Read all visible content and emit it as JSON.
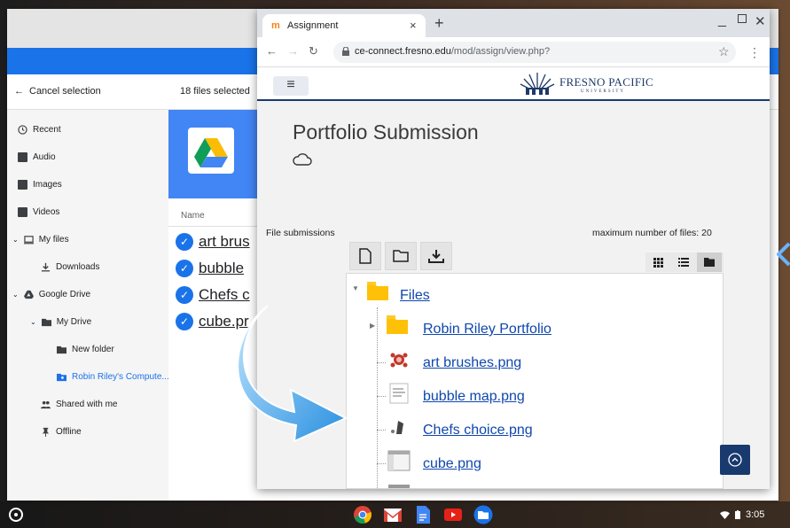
{
  "files_app": {
    "toolbar": {
      "cancel_selection": "Cancel selection",
      "selected_count": "18 files selected"
    },
    "sidebar": {
      "items": [
        {
          "label": "Recent",
          "icon": "clock-icon"
        },
        {
          "label": "Audio",
          "icon": "audio-icon"
        },
        {
          "label": "Images",
          "icon": "image-icon"
        },
        {
          "label": "Videos",
          "icon": "video-icon"
        },
        {
          "label": "My files",
          "icon": "computer-icon"
        },
        {
          "label": "Downloads",
          "icon": "download-icon"
        },
        {
          "label": "Google Drive",
          "icon": "drive-icon"
        },
        {
          "label": "My Drive",
          "icon": "folder-icon"
        },
        {
          "label": "New folder",
          "icon": "folder-icon"
        },
        {
          "label": "Robin Riley's Compute...",
          "icon": "folder-shared-icon"
        },
        {
          "label": "Shared with me",
          "icon": "people-icon"
        },
        {
          "label": "Offline",
          "icon": "pin-icon"
        }
      ]
    },
    "list": {
      "column_name": "Name",
      "files": [
        "art brus",
        "bubble",
        "Chefs c",
        "cube.pr"
      ]
    }
  },
  "browser": {
    "tab": {
      "title": "Assignment",
      "close": "×"
    },
    "new_tab": "+",
    "url": {
      "host": "ce-connect.fresno.edu",
      "path": "/mod/assign/view.php?"
    },
    "site": {
      "logo_name": "FRESNO PACIFIC",
      "logo_sub": "UNIVERSITY"
    },
    "page": {
      "title": "Portfolio Submission",
      "file_submissions_label": "File submissions",
      "max_files": "maximum number of files: 20"
    },
    "tree": {
      "root": "Files",
      "folder": "Robin Riley Portfolio",
      "files": [
        "art brushes.png",
        "bubble map.png",
        "Chefs choice.png",
        "cube.png"
      ]
    }
  },
  "shelf": {
    "time": "3:05"
  },
  "colors": {
    "accent": "#1a73e8",
    "moodle_link": "#0f47ad",
    "fpu_navy": "#183a6e",
    "folder_yellow": "#ffc107"
  }
}
